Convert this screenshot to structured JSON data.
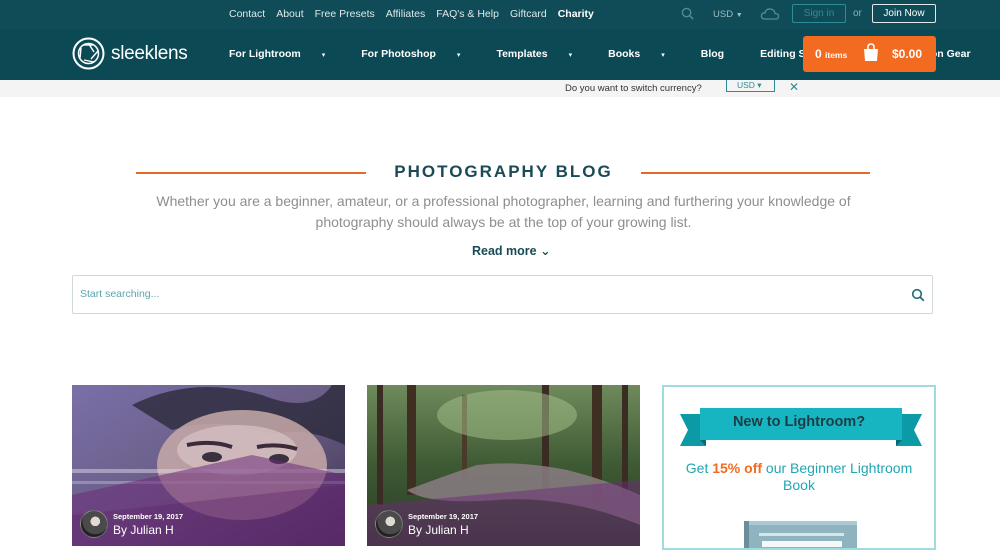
{
  "topbar": {
    "links": [
      "Contact",
      "About",
      "Free Presets",
      "Affiliates",
      "FAQ's & Help",
      "Giftcard"
    ],
    "highlight_link": "Charity",
    "currency": "USD",
    "sign_in": "Sign in",
    "or": "or",
    "join": "Join Now"
  },
  "nav": {
    "logo": "sleeklens",
    "items": [
      {
        "label": "For Lightroom",
        "caret": "▾"
      },
      {
        "label": "For Photoshop",
        "caret": "▾"
      },
      {
        "label": "Templates",
        "caret": "▾"
      },
      {
        "label": "Books",
        "caret": "▾"
      },
      {
        "label": "Blog",
        "caret": ""
      },
      {
        "label": "Editing Service",
        "caret": ""
      },
      {
        "label": "Daily Deals on Gear",
        "caret": ""
      }
    ],
    "cart": {
      "count": "0",
      "items_label": "items",
      "total": "$0.00"
    }
  },
  "currency_prompt": {
    "question": "Do you want to switch currency?",
    "value": "USD ▾",
    "close": "✕"
  },
  "blog": {
    "title": "PHOTOGRAPHY BLOG",
    "description": "Whether you are a beginner, amateur, or a professional photographer, learning and furthering your knowledge of photography should always be at the top of your growing list.",
    "read_more": "Read more ⌄"
  },
  "search": {
    "placeholder": "Start searching..."
  },
  "posts": [
    {
      "date": "September 19, 2017",
      "author": "By Julian H"
    },
    {
      "date": "September 19, 2017",
      "author": "By Julian H"
    }
  ],
  "promo": {
    "title": "New to Lightroom?",
    "text_before": "Get ",
    "highlight": "15% off",
    "text_after": " our Beginner Lightroom Book"
  },
  "colors": {
    "accent": "#f26b21",
    "nav": "#0b4a55",
    "teal": "#20a7b3"
  }
}
